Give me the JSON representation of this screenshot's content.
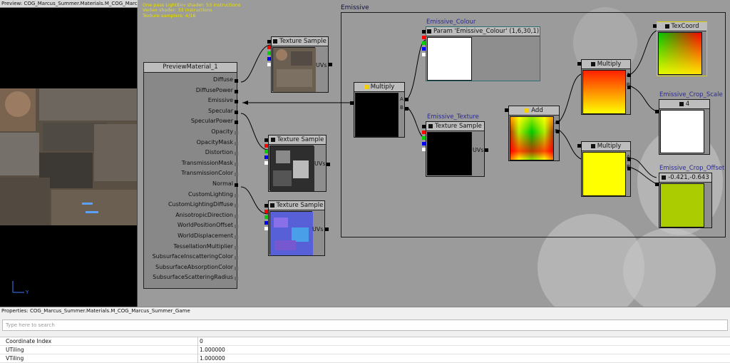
{
  "preview": {
    "title": "Preview: COG_Marcus_Summer.Materials.M_COG_Marcu...",
    "close": "✕",
    "axis_y": "Y"
  },
  "stats": {
    "line1": "One pass LightEnv shader: 53 instructions",
    "line2": "Vertex shader: 33 instructions",
    "line3": "Texture samplers: 4/16"
  },
  "comment": {
    "label": "Emissive"
  },
  "material": {
    "title": "PreviewMaterial_1",
    "inputs": [
      "Diffuse",
      "DiffusePower",
      "Emissive",
      "Specular",
      "SpecularPower",
      "Opacity",
      "OpacityMask",
      "Distortion",
      "TransmissionMask",
      "TransmissionColor",
      "Normal",
      "CustomLighting",
      "CustomLightingDiffuse",
      "AnisotropicDirection",
      "WorldPositionOffset",
      "WorldDisplacement",
      "TessellationMultiplier",
      "SubsurfaceInscatteringColor",
      "SubsurfaceAbsorptionColor",
      "SubsurfaceScatteringRadius"
    ]
  },
  "nodes": {
    "tex1": {
      "header": "Texture Sample",
      "out": "UVs"
    },
    "tex2": {
      "header": "Texture Sample",
      "out": "UVs"
    },
    "tex3": {
      "header": "Texture Sample",
      "out": "UVs"
    },
    "multiply1": {
      "header": "Multiply",
      "a": "A",
      "b": "B"
    },
    "emissive_colour": {
      "title": "Emissive_Colour",
      "header": "Param 'Emissive_Colour' (1,6,30,1)"
    },
    "emissive_texture": {
      "title": "Emissive_Texture",
      "header": "Texture Sample",
      "out": "UVs"
    },
    "add": {
      "header": "Add",
      "a": "A",
      "b": "B"
    },
    "multiply2": {
      "header": "Multiply",
      "a": "A",
      "b": "B"
    },
    "multiply3": {
      "header": "Multiply",
      "a": "A",
      "b": "B"
    },
    "texcoord": {
      "header": "TexCoord"
    },
    "crop_scale": {
      "title": "Emissive_Crop_Scale",
      "header": "4"
    },
    "crop_offset": {
      "title": "Emissive_Crop_Offset",
      "header": "-0.421,-0.643"
    }
  },
  "properties": {
    "title": "Properties: COG_Marcus_Summer.Materials.M_COG_Marcus_Summer_Game",
    "search_placeholder": "Type here to search",
    "rows": [
      {
        "key": "Coordinate Index",
        "value": "0"
      },
      {
        "key": "UTiling",
        "value": "1.000000"
      },
      {
        "key": "VTiling",
        "value": "1.000000"
      }
    ]
  }
}
